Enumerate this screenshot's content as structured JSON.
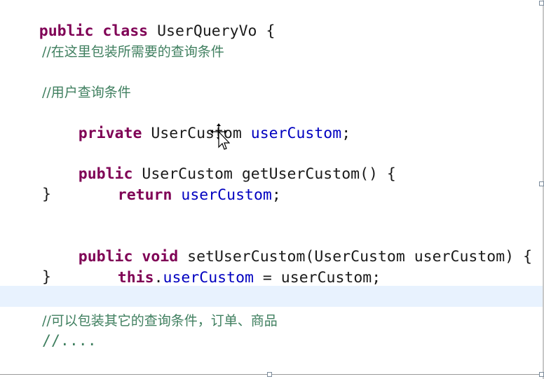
{
  "code": {
    "l1": {
      "kw1": "public",
      "kw2": "class",
      "name": "UserQueryVo",
      "brace": "{"
    },
    "l2": {
      "comment": "//在这里包装所需要的查询条件"
    },
    "l3": {
      "comment": "//用户查询条件"
    },
    "l4": {
      "kw": "private",
      "type": "UserCustom",
      "field": "userCustom",
      "end": ";"
    },
    "l5": {
      "kw": "public",
      "type": "UserCustom",
      "method": "getUserCustom() {"
    },
    "l6": {
      "kw": "return",
      "field": "userCustom",
      "end": ";"
    },
    "l7": {
      "brace": "}"
    },
    "l8": {
      "kw1": "public",
      "kw2": "void",
      "rest": "setUserCustom(UserCustom userCustom) {"
    },
    "l9": {
      "kw": "this",
      "dot": ".",
      "field": "userCustom",
      "rest": " = userCustom;"
    },
    "l10": {
      "brace": "}"
    },
    "l11": {
      "comment": "//可以包装其它的查询条件，订单、商品"
    },
    "l12": {
      "comment": "//...."
    }
  },
  "colors": {
    "keyword": "#7f0055",
    "field": "#0000c0",
    "comment": "#3f7f5f",
    "current_line": "#e8f2fe"
  }
}
